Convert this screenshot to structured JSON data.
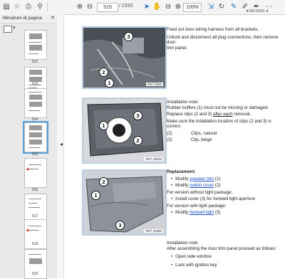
{
  "toolbar": {
    "page_current": "515",
    "page_total": "/ 2330",
    "zoom": "100%"
  },
  "sidebar": {
    "title": "Miniature di pagina",
    "thumb_labels": [
      "512",
      "513",
      "514",
      "515",
      "516",
      "517",
      "518",
      "519"
    ]
  },
  "document": {
    "date": "4/30/2016 4",
    "fig1_label": "RS7 0066",
    "fig2_label": "RS7 10019",
    "fig3_label": "RS7 10068",
    "step1_line1": "Feed out door wiring harness from all brackets.",
    "step1_line2": "Unlock and disconnect all plug connections, then remove door",
    "step1_line3": "trim panel.",
    "note1_title": "Installation note:",
    "note1_line1": "Rubber buffers (1) must not be missing or damaged.",
    "note1_line2a": "Replace clips (2 and 3) ",
    "note1_line2b": "after each",
    "note1_line2c": " removal.",
    "note1_line3": "Make sure the installation location of clips (2 and 3) is correct.",
    "clip2_num": "(2)",
    "clip2_desc": "Clips, natural",
    "clip3_num": "(3)",
    "clip3_desc": "Clip, beige",
    "replacement_title": "Replacement:",
    "repl_1a": "Modify ",
    "repl_1b": "speaker trim",
    "repl_1c": " (1)",
    "repl_2a": "Modify ",
    "repl_2b": "switch cover",
    "repl_2c": " (2)",
    "repl_3": "For version without light package:",
    "repl_4": "Install cover (3) for footwell light aperture",
    "repl_5": "For version with light package:",
    "repl_6a": "Modify ",
    "repl_6b": "footwell light",
    "repl_6c": " (3)",
    "note2_title": "Installation note:",
    "note2_line1": "After assembling the door trim panel proceed as follows:",
    "note2_b1": "Open side window",
    "note2_b2": "Lock with ignition key"
  }
}
